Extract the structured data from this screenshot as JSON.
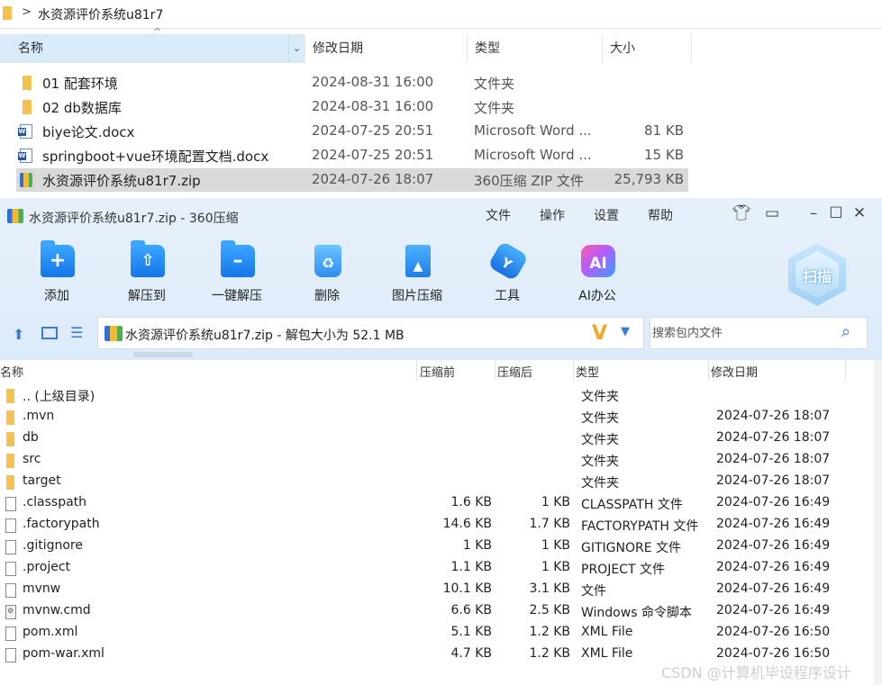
{
  "explorer": {
    "path": "水资源评价系统u81r7",
    "columns": {
      "name": "名称",
      "date": "修改日期",
      "type": "类型",
      "size": "大小"
    },
    "files": [
      {
        "name": "01 配套环境",
        "date": "2024-08-31 16:00",
        "type": "文件夹",
        "size": "",
        "icon": "folder-icon"
      },
      {
        "name": "02 db数据库",
        "date": "2024-08-31 16:00",
        "type": "文件夹",
        "size": "",
        "icon": "folder-icon"
      },
      {
        "name": "biye论文.docx",
        "date": "2024-07-25 20:51",
        "type": "Microsoft Word ...",
        "size": "81 KB",
        "icon": "word-doc-icon"
      },
      {
        "name": "springboot+vue环境配置文档.docx",
        "date": "2024-07-25 20:51",
        "type": "Microsoft Word ...",
        "size": "15 KB",
        "icon": "word-doc-icon"
      },
      {
        "name": "水资源评价系统u81r7.zip",
        "date": "2024-07-26 18:07",
        "type": "360压缩 ZIP 文件",
        "size": "25,793 KB",
        "icon": "zip-archive-icon",
        "selected": true
      }
    ]
  },
  "zip": {
    "title": "水资源评价系统u81r7.zip - 360压缩",
    "menu": [
      "文件",
      "操作",
      "设置",
      "帮助"
    ],
    "window_controls": [
      "shirt-skin-icon",
      "feedback-icon",
      "minimize-icon",
      "maximize-icon",
      "close-icon"
    ],
    "toolbar": [
      {
        "label": "添加",
        "icon": "add-folder-icon"
      },
      {
        "label": "解压到",
        "icon": "extract-to-icon"
      },
      {
        "label": "一键解压",
        "icon": "one-click-extract-icon"
      },
      {
        "label": "删除",
        "icon": "delete-trash-icon"
      },
      {
        "label": "图片压缩",
        "icon": "image-compress-icon"
      },
      {
        "label": "工具",
        "icon": "tools-icon"
      },
      {
        "label": "AI办公",
        "icon": "ai-office-icon"
      }
    ],
    "scan_label": "扫描",
    "address": "水资源评价系统u81r7.zip - 解包大小为 52.1 MB",
    "search_placeholder": "搜索包内文件",
    "columns": {
      "name": "名称",
      "compressed_before": "压缩前",
      "compressed_after": "压缩后",
      "type": "类型",
      "modified": "修改日期"
    },
    "entries": [
      {
        "name": ".. (上级目录)",
        "before": "",
        "after": "",
        "type": "文件夹",
        "date": "",
        "kind": "folder"
      },
      {
        "name": ".mvn",
        "before": "",
        "after": "",
        "type": "文件夹",
        "date": "2024-07-26 18:07",
        "kind": "folder"
      },
      {
        "name": "db",
        "before": "",
        "after": "",
        "type": "文件夹",
        "date": "2024-07-26 18:07",
        "kind": "folder"
      },
      {
        "name": "src",
        "before": "",
        "after": "",
        "type": "文件夹",
        "date": "2024-07-26 18:07",
        "kind": "folder"
      },
      {
        "name": "target",
        "before": "",
        "after": "",
        "type": "文件夹",
        "date": "2024-07-26 18:07",
        "kind": "folder"
      },
      {
        "name": ".classpath",
        "before": "1.6 KB",
        "after": "1 KB",
        "type": "CLASSPATH 文件",
        "date": "2024-07-26 16:49",
        "kind": "file"
      },
      {
        "name": ".factorypath",
        "before": "14.6 KB",
        "after": "1.7 KB",
        "type": "FACTORYPATH 文件",
        "date": "2024-07-26 16:49",
        "kind": "file"
      },
      {
        "name": ".gitignore",
        "before": "1 KB",
        "after": "1 KB",
        "type": "GITIGNORE 文件",
        "date": "2024-07-26 16:49",
        "kind": "file"
      },
      {
        "name": ".project",
        "before": "1.1 KB",
        "after": "1 KB",
        "type": "PROJECT 文件",
        "date": "2024-07-26 16:49",
        "kind": "file"
      },
      {
        "name": "mvnw",
        "before": "10.1 KB",
        "after": "3.1 KB",
        "type": "文件",
        "date": "2024-07-26 16:49",
        "kind": "file"
      },
      {
        "name": "mvnw.cmd",
        "before": "6.6 KB",
        "after": "2.5 KB",
        "type": "Windows 命令脚本",
        "date": "2024-07-26 16:49",
        "kind": "cmd"
      },
      {
        "name": "pom.xml",
        "before": "5.1 KB",
        "after": "1.2 KB",
        "type": "XML File",
        "date": "2024-07-26 16:50",
        "kind": "file"
      },
      {
        "name": "pom-war.xml",
        "before": "4.7 KB",
        "after": "1.2 KB",
        "type": "XML File",
        "date": "2024-07-26 16:50",
        "kind": "file"
      }
    ]
  },
  "watermark": "CSDN @计算机毕设程序设计"
}
